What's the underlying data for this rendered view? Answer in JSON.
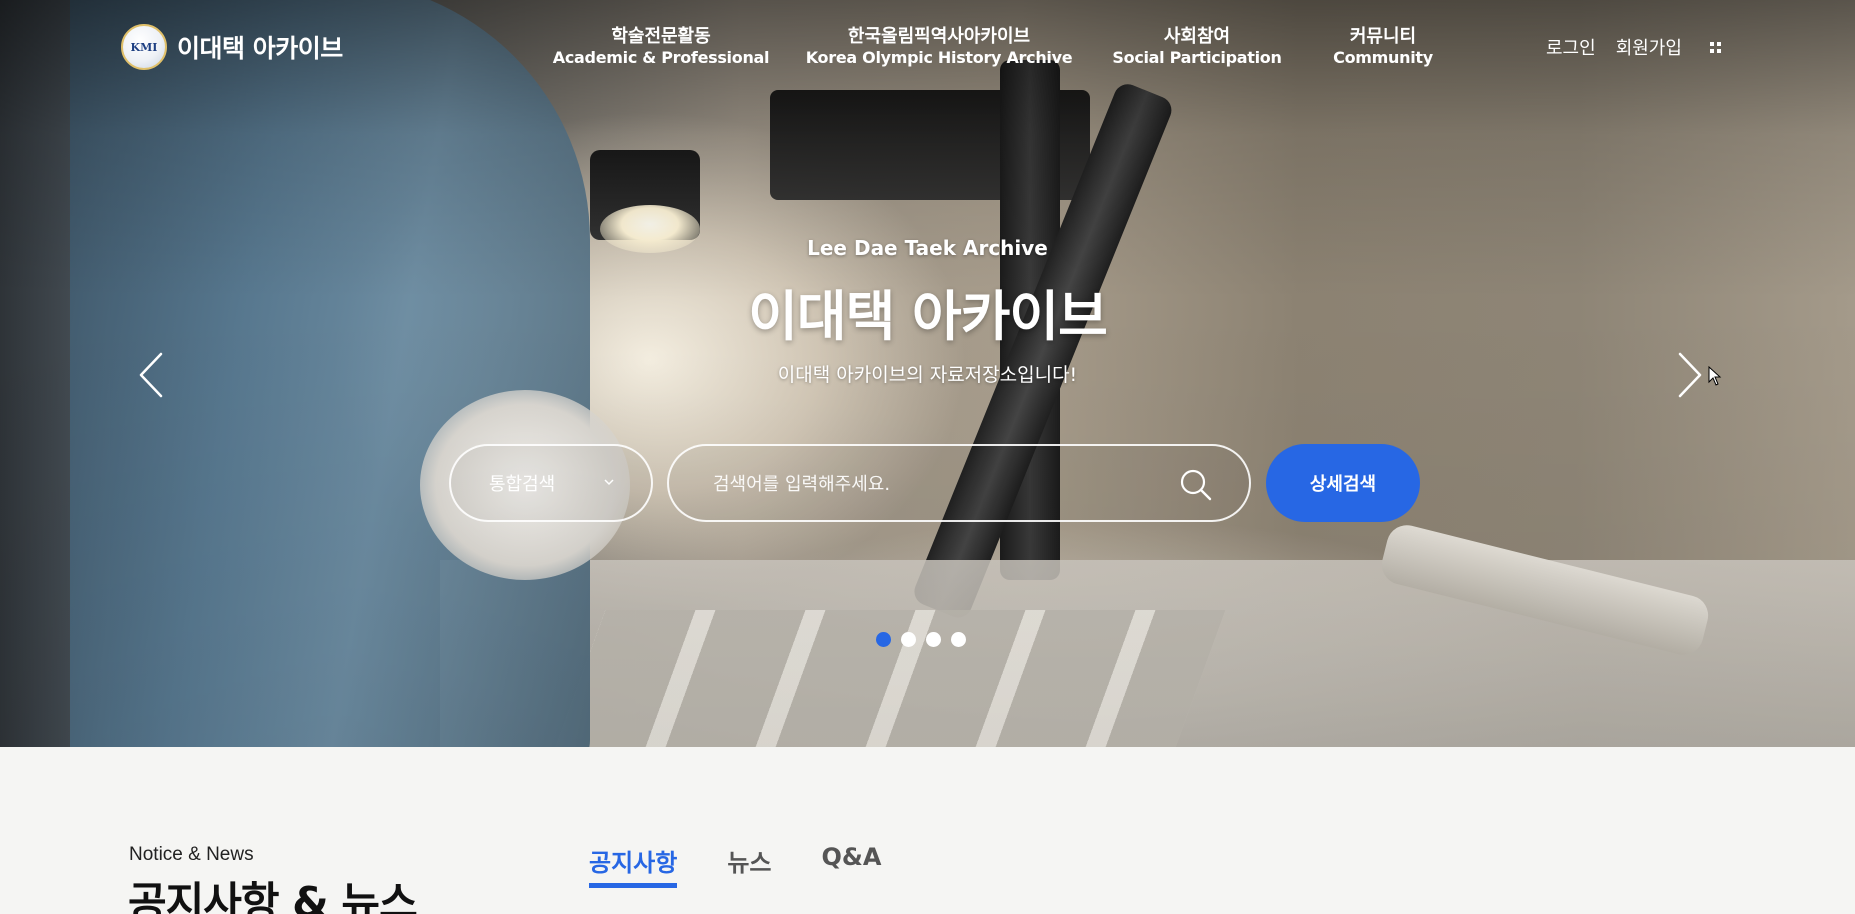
{
  "header": {
    "logo_text": "이대택 아카이브",
    "logo_mark": "KMI",
    "nav": [
      {
        "ko": "학술전문활동",
        "en": "Academic & Professional"
      },
      {
        "ko": "한국올림픽역사아카이브",
        "en": "Korea Olympic History Archive"
      },
      {
        "ko": "사회참여",
        "en": "Social Participation"
      },
      {
        "ko": "커뮤니티",
        "en": "Community"
      }
    ],
    "util": {
      "login": "로그인",
      "signup": "회원가입",
      "menu_icon": "grid-menu-icon"
    }
  },
  "hero": {
    "subtitle": "Lee Dae Taek Archive",
    "title": "이대택 아카이브",
    "description": "이대택 아카이브의 자료저장소입니다!",
    "prev_icon": "chevron-left-icon",
    "next_icon": "chevron-right-icon",
    "slides_total": 4,
    "active_slide": 1
  },
  "search": {
    "scope_selected": "통합검색",
    "placeholder": "검색어를 입력해주세요.",
    "value": "",
    "search_icon": "search-icon",
    "detail_button": "상세검색"
  },
  "notice": {
    "eyebrow": "Notice & News",
    "title": "공지사항 & 뉴스",
    "tabs": [
      {
        "label": "공지사항",
        "active": true
      },
      {
        "label": "뉴스",
        "active": false
      },
      {
        "label": "Q&A",
        "active": false
      }
    ]
  },
  "colors": {
    "accent": "#2767e4",
    "text_dark": "#111111",
    "background": "#f5f5f3"
  }
}
